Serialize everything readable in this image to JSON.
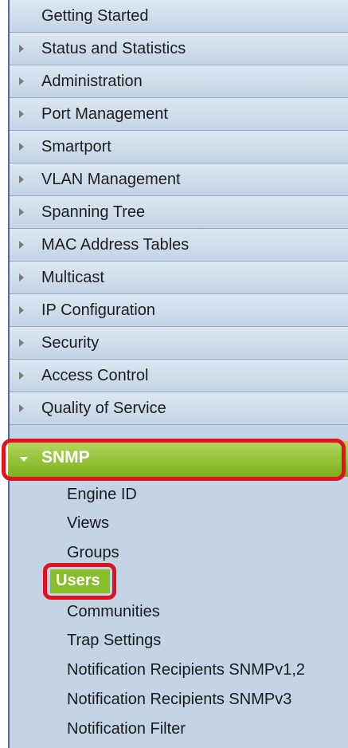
{
  "nav": {
    "items": [
      {
        "label": "Getting Started",
        "arrow": false
      },
      {
        "label": "Status and Statistics",
        "arrow": true
      },
      {
        "label": "Administration",
        "arrow": true
      },
      {
        "label": "Port Management",
        "arrow": true
      },
      {
        "label": "Smartport",
        "arrow": true
      },
      {
        "label": "VLAN Management",
        "arrow": true
      },
      {
        "label": "Spanning Tree",
        "arrow": true
      },
      {
        "label": "MAC Address Tables",
        "arrow": true
      },
      {
        "label": "Multicast",
        "arrow": true
      },
      {
        "label": "IP Configuration",
        "arrow": true
      },
      {
        "label": "Security",
        "arrow": true
      },
      {
        "label": "Access Control",
        "arrow": true
      },
      {
        "label": "Quality of Service",
        "arrow": true
      }
    ],
    "expanded": {
      "label": "SNMP",
      "children": [
        "Engine ID",
        "Views",
        "Groups",
        "Users",
        "Communities",
        "Trap Settings",
        "Notification Recipients SNMPv1,2",
        "Notification Recipients SNMPv3",
        "Notification Filter"
      ],
      "selected": "Users"
    }
  },
  "colors": {
    "nav_background": "#c3d4e6",
    "snmp_green": "#7cb11a",
    "selected_green": "#89be2b",
    "highlight_red": "#e0121f"
  }
}
